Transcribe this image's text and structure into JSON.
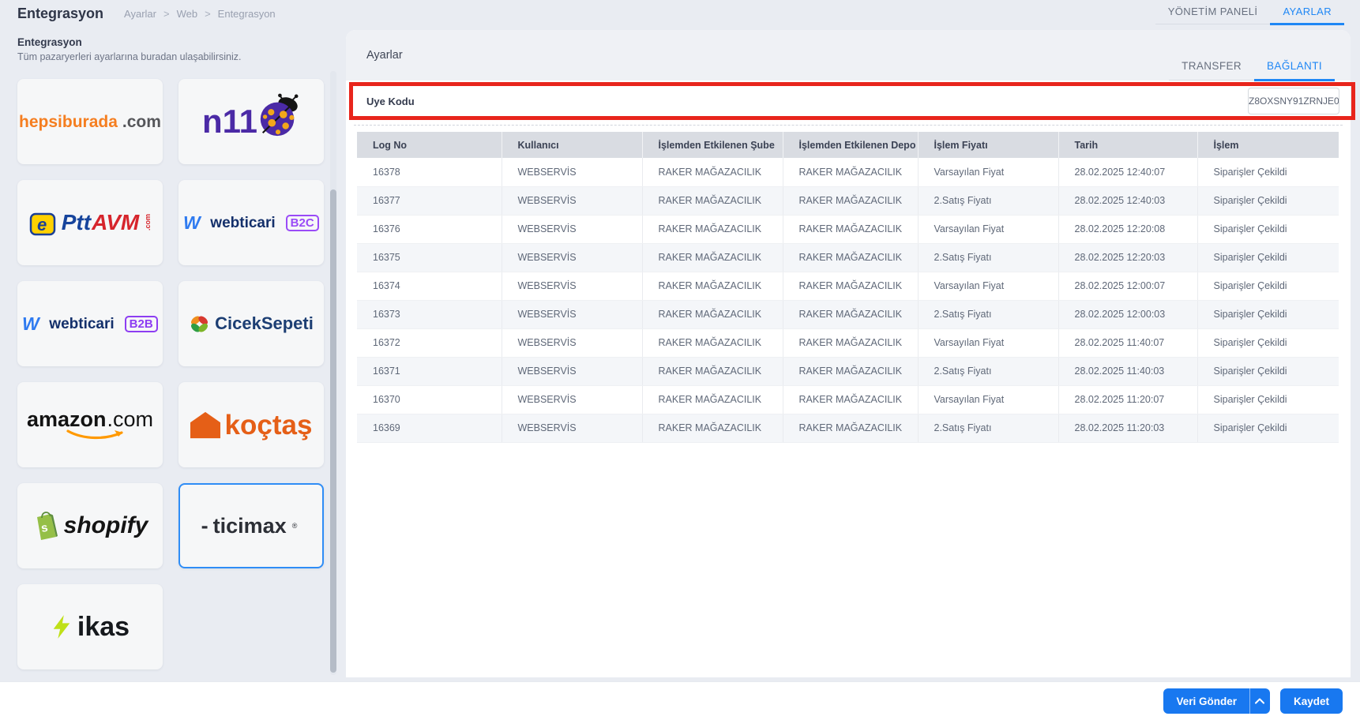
{
  "colors": {
    "accent_blue": "#1f87f5",
    "button_blue": "#1878f0",
    "annotation_red": "#e8251c",
    "table_header_bg": "#d9dce2"
  },
  "header": {
    "app_title": "Entegrasyon",
    "breadcrumb": {
      "items": [
        "Ayarlar",
        "Web",
        "Entegrasyon"
      ],
      "separator": ">"
    },
    "top_tabs": [
      {
        "label": "YÖNETİM PANELİ",
        "active": false
      },
      {
        "label": "AYARLAR",
        "active": true
      }
    ]
  },
  "sidebar": {
    "heading": "Entegrasyon",
    "description": "Tüm pazaryerleri ayarlarına buradan ulaşabilirsiniz.",
    "marketplaces": [
      {
        "id": "hepsiburada",
        "name": "hepsiburada.com",
        "selected": false,
        "parts": [
          {
            "text": "hepsiburada",
            "color": "#f57e20",
            "size": 21,
            "weight": 700
          },
          {
            "text": ".com",
            "color": "#55565a",
            "size": 21,
            "weight": 700
          }
        ]
      },
      {
        "id": "n11",
        "name": "n11",
        "selected": false,
        "icon": "ladybug-icon",
        "icon_position": "right",
        "parts": [
          {
            "text": "n11",
            "color": "#4b2aa6",
            "size": 42,
            "weight": 800
          }
        ]
      },
      {
        "id": "pttavm",
        "name": "ePttAVM.com",
        "selected": false,
        "icon": "eptt-badge-icon",
        "parts": [
          {
            "text": "Ptt",
            "color": "#16449c",
            "size": 28,
            "weight": 800,
            "italic": true
          },
          {
            "text": "AVM",
            "color": "#d6252c",
            "size": 28,
            "weight": 800,
            "italic": true,
            "tight": true
          },
          {
            "text": ".com",
            "color": "#d6252c",
            "size": 9,
            "weight": 700,
            "vertical": true
          }
        ]
      },
      {
        "id": "webticari-b2c",
        "name": "webticari B2C",
        "selected": false,
        "icon": "webticari-w-icon",
        "parts": [
          {
            "text": "webticari",
            "color": "#14306b",
            "size": 19,
            "weight": 800
          },
          {
            "text": "B2C",
            "color": "#9a4bf7",
            "size": 15,
            "weight": 800,
            "badge": true
          }
        ]
      },
      {
        "id": "webticari-b2b",
        "name": "webticari B2B",
        "selected": false,
        "icon": "webticari-w-icon",
        "parts": [
          {
            "text": "webticari",
            "color": "#14306b",
            "size": 19,
            "weight": 800
          },
          {
            "text": "B2B",
            "color": "#8d3df2",
            "size": 15,
            "weight": 800,
            "badge": true
          }
        ]
      },
      {
        "id": "ciceksepeti",
        "name": "CicekSepeti",
        "selected": false,
        "icon": "flower-icon",
        "parts": [
          {
            "text": "CicekSepeti",
            "color": "#1c3e73",
            "size": 22,
            "weight": 800
          }
        ]
      },
      {
        "id": "amazon",
        "name": "amazon.com",
        "selected": false,
        "icon": "amazon-smile-icon",
        "icon_position": "below",
        "parts": [
          {
            "text": "amazon",
            "color": "#131313",
            "size": 27,
            "weight": 800
          },
          {
            "text": ".com",
            "color": "#131313",
            "size": 27,
            "weight": 400,
            "tight": true
          }
        ]
      },
      {
        "id": "koctas",
        "name": "koçtaş",
        "selected": false,
        "icon": "koctas-house-icon",
        "parts": [
          {
            "text": "koçtaş",
            "color": "#e55f17",
            "size": 35,
            "weight": 800
          }
        ]
      },
      {
        "id": "shopify",
        "name": "shopify",
        "selected": false,
        "icon": "shopify-bag-icon",
        "parts": [
          {
            "text": "shopify",
            "color": "#141414",
            "size": 30,
            "weight": 800,
            "italic": true
          }
        ]
      },
      {
        "id": "ticimax",
        "name": "ticimax",
        "selected": true,
        "parts": [
          {
            "text": "-",
            "color": "#2c2f36",
            "size": 27,
            "weight": 700,
            "tight": true
          },
          {
            "text": "ticimax",
            "color": "#2c2f36",
            "size": 27,
            "weight": 700
          },
          {
            "text": "®",
            "color": "#2c2f36",
            "size": 9,
            "weight": 400,
            "sup": true
          }
        ]
      },
      {
        "id": "ikas",
        "name": "ikas",
        "selected": false,
        "icon": "bolt-icon",
        "parts": [
          {
            "text": "ikas",
            "color": "#16191d",
            "size": 34,
            "weight": 800
          }
        ]
      }
    ]
  },
  "panel": {
    "title": "Ayarlar",
    "tabs": [
      {
        "label": "TRANSFER",
        "active": false
      },
      {
        "label": "BAĞLANTI",
        "active": true
      }
    ],
    "member_code": {
      "label": "Uye Kodu",
      "value": "Z8OXSNY91ZRNJE0"
    }
  },
  "log_table": {
    "columns": [
      "Log No",
      "Kullanıcı",
      "İşlemden Etkilenen Şube",
      "İşlemden Etkilenen Depo",
      "İşlem Fiyatı",
      "Tarih",
      "İşlem"
    ],
    "rows": [
      [
        "16378",
        "WEBSERVİS",
        "RAKER MAĞAZACILIK",
        "RAKER MAĞAZACILIK",
        "Varsayılan Fiyat",
        "28.02.2025 12:40:07",
        "Siparişler Çekildi"
      ],
      [
        "16377",
        "WEBSERVİS",
        "RAKER MAĞAZACILIK",
        "RAKER MAĞAZACILIK",
        "2.Satış Fiyatı",
        "28.02.2025 12:40:03",
        "Siparişler Çekildi"
      ],
      [
        "16376",
        "WEBSERVİS",
        "RAKER MAĞAZACILIK",
        "RAKER MAĞAZACILIK",
        "Varsayılan Fiyat",
        "28.02.2025 12:20:08",
        "Siparişler Çekildi"
      ],
      [
        "16375",
        "WEBSERVİS",
        "RAKER MAĞAZACILIK",
        "RAKER MAĞAZACILIK",
        "2.Satış Fiyatı",
        "28.02.2025 12:20:03",
        "Siparişler Çekildi"
      ],
      [
        "16374",
        "WEBSERVİS",
        "RAKER MAĞAZACILIK",
        "RAKER MAĞAZACILIK",
        "Varsayılan Fiyat",
        "28.02.2025 12:00:07",
        "Siparişler Çekildi"
      ],
      [
        "16373",
        "WEBSERVİS",
        "RAKER MAĞAZACILIK",
        "RAKER MAĞAZACILIK",
        "2.Satış Fiyatı",
        "28.02.2025 12:00:03",
        "Siparişler Çekildi"
      ],
      [
        "16372",
        "WEBSERVİS",
        "RAKER MAĞAZACILIK",
        "RAKER MAĞAZACILIK",
        "Varsayılan Fiyat",
        "28.02.2025 11:40:07",
        "Siparişler Çekildi"
      ],
      [
        "16371",
        "WEBSERVİS",
        "RAKER MAĞAZACILIK",
        "RAKER MAĞAZACILIK",
        "2.Satış Fiyatı",
        "28.02.2025 11:40:03",
        "Siparişler Çekildi"
      ],
      [
        "16370",
        "WEBSERVİS",
        "RAKER MAĞAZACILIK",
        "RAKER MAĞAZACILIK",
        "Varsayılan Fiyat",
        "28.02.2025 11:20:07",
        "Siparişler Çekildi"
      ],
      [
        "16369",
        "WEBSERVİS",
        "RAKER MAĞAZACILIK",
        "RAKER MAĞAZACILIK",
        "2.Satış Fiyatı",
        "28.02.2025 11:20:03",
        "Siparişler Çekildi"
      ]
    ]
  },
  "footer": {
    "send_label": "Veri Gönder",
    "save_label": "Kaydet",
    "caret_icon": "chevron-up-icon"
  }
}
